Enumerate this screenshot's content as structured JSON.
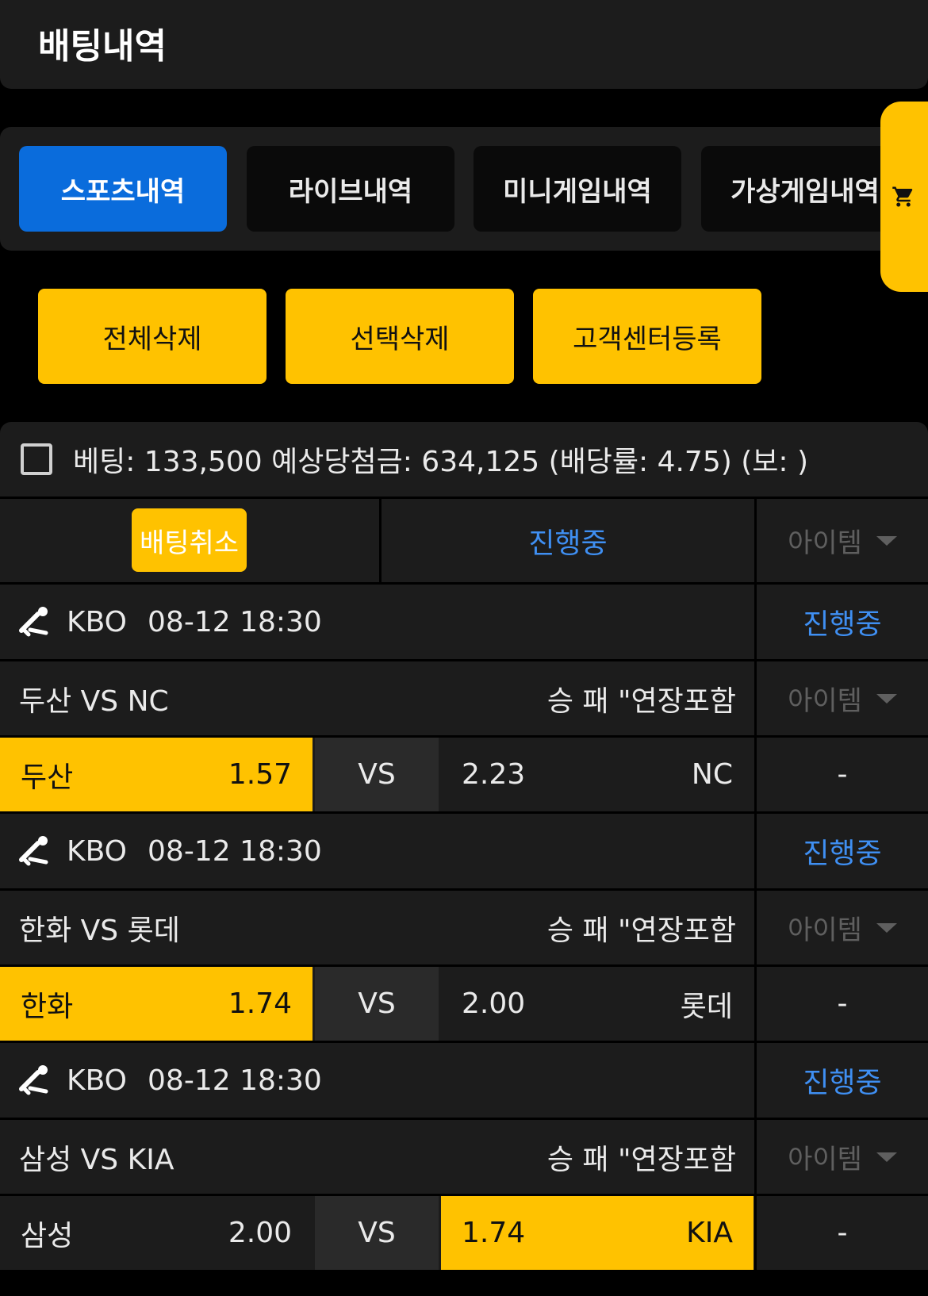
{
  "header": {
    "title": "배팅내역"
  },
  "tabs": [
    {
      "label": "스포츠내역",
      "active": true
    },
    {
      "label": "라이브내역",
      "active": false
    },
    {
      "label": "미니게임내역",
      "active": false
    },
    {
      "label": "가상게임내역",
      "active": false
    }
  ],
  "cart_icon": "cart-icon",
  "actions": {
    "delete_all": "전체삭제",
    "delete_selected": "선택삭제",
    "register_support": "고객센터등록"
  },
  "summary": {
    "text": "베팅: 133,500 예상당첨금: 634,125 (배당률: 4.75) (보: )"
  },
  "bet_status_row": {
    "cancel_label": "배팅취소",
    "status": "진행중",
    "item_label": "아이템"
  },
  "games": [
    {
      "league": "KBO",
      "datetime": "08-12 18:30",
      "status": "진행중",
      "match": "두산 VS NC",
      "market": "승 패 \"연장포함",
      "item_label": "아이템",
      "home_team": "두산",
      "home_odds": "1.57",
      "vs": "VS",
      "away_odds": "2.23",
      "away_team": "NC",
      "selected": "home",
      "result": "-"
    },
    {
      "league": "KBO",
      "datetime": "08-12 18:30",
      "status": "진행중",
      "match": "한화 VS 롯데",
      "market": "승 패 \"연장포함",
      "item_label": "아이템",
      "home_team": "한화",
      "home_odds": "1.74",
      "vs": "VS",
      "away_odds": "2.00",
      "away_team": "롯데",
      "selected": "home",
      "result": "-"
    },
    {
      "league": "KBO",
      "datetime": "08-12 18:30",
      "status": "진행중",
      "match": "삼성 VS KIA",
      "market": "승 패 \"연장포함",
      "item_label": "아이템",
      "home_team": "삼성",
      "home_odds": "2.00",
      "vs": "VS",
      "away_odds": "1.74",
      "away_team": "KIA",
      "selected": "away",
      "result": "-"
    }
  ],
  "colors": {
    "accent_yellow": "#ffc200",
    "active_tab_blue": "#0a6cdc",
    "status_blue": "#3f8ff2",
    "panel": "#1c1c1c"
  },
  "league_icon": "baseball-icon"
}
